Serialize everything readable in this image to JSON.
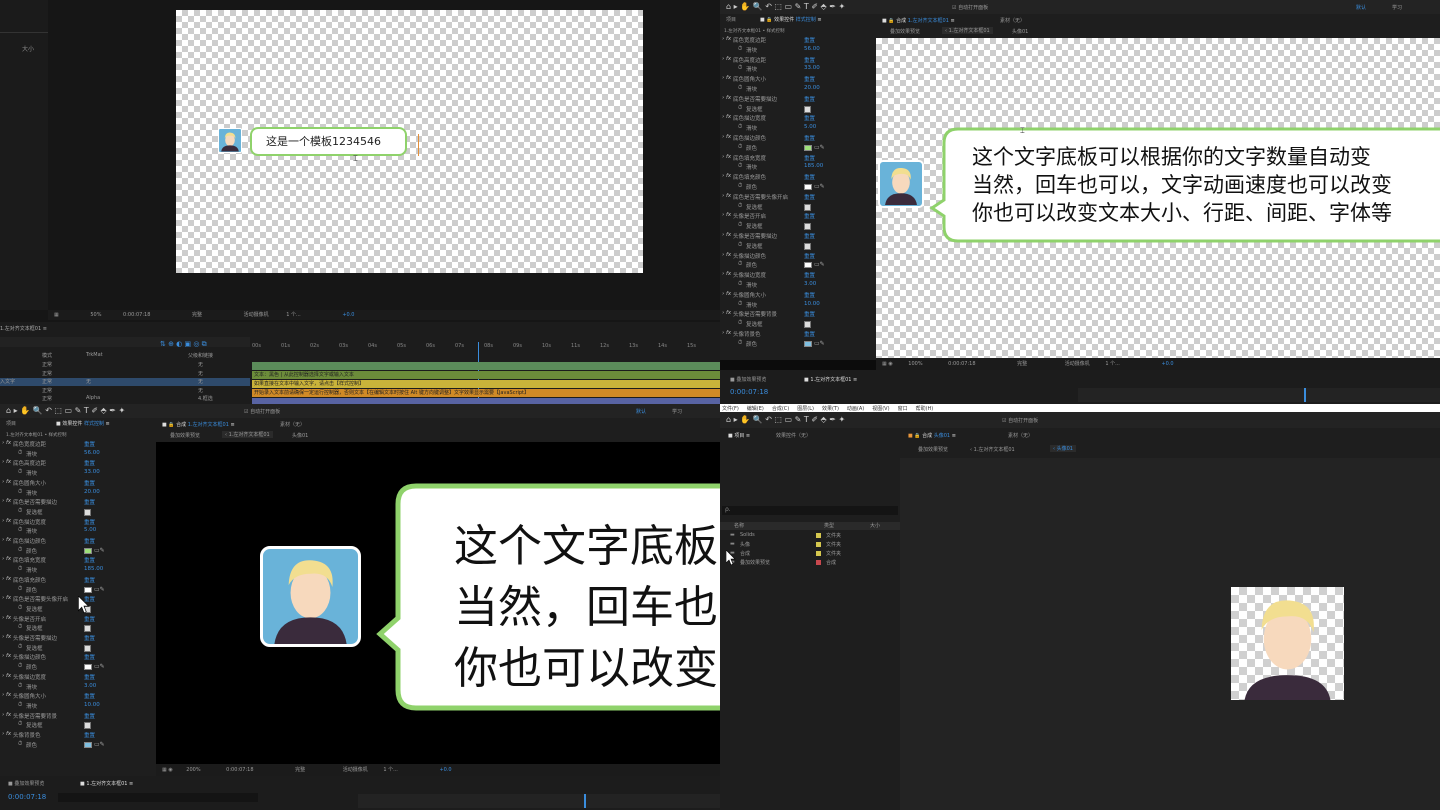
{
  "q1": {
    "left_panel_header": "大小",
    "comp_text": "这是一个模板1234546",
    "status": {
      "zoom": "50%",
      "time": "0:00:07:18",
      "quality": "完整",
      "camera": "活动摄像机",
      "views": "1 个...",
      "offset": "+0.0"
    }
  },
  "q2": {
    "menu": {
      "auto_open": "自动打开面板",
      "default": "默认",
      "learn": "学习"
    },
    "panel_tab": "效果控件",
    "panel_tab_sub": "样式控制",
    "comp_tab": "合成",
    "comp_name": "1.左对齐文本框01",
    "layer_tab": "素材（无）",
    "breadcrumb": [
      "叠加效果预览",
      "1.左对齐文本框01",
      "头像01"
    ],
    "bubble_text": [
      "这个文字底板可以根据你的文字数量自动变",
      "当然，回车也可以，文字动画速度也可以改变",
      "你也可以改变文本大小、行距、间距、字体等"
    ],
    "status": {
      "zoom": "100%",
      "time": "0:00:07:18",
      "quality": "完整",
      "camera": "活动摄像机",
      "views": "1 个...",
      "offset": "+0.0"
    },
    "timeline_tabs": [
      "叠加效果预览",
      "1.左对齐文本框01"
    ],
    "timeline_time": "0:00:07:18"
  },
  "q3": {
    "layer_header": [
      "模式",
      "TrkMat",
      "父级和链接"
    ],
    "modes": [
      "正常",
      "正常",
      "正常",
      "正常",
      "正常"
    ],
    "parent": [
      "无",
      "无",
      "无",
      "4.框选",
      "无"
    ],
    "layer_name": "入文字",
    "alpha": "Alpha",
    "ruler": [
      "00s",
      "01s",
      "02s",
      "03s",
      "04s",
      "05s",
      "06s",
      "07s",
      "08s",
      "09s",
      "10s",
      "11s",
      "12s",
      "13s",
      "14s",
      "15s"
    ],
    "tracks": [
      "",
      "文本：黑色 | 从此控制器选择文字或输入文本",
      "如果直接在文本中输入文字，请点击【样式控制】",
      "开始录入文本前请确保一定运行控制器，否则文本【在编辑文本时按住 Alt 键方向键调整】文字效果显示需要【JavaScript】",
      ""
    ],
    "auto_open": "自动打开面板",
    "default": "默认",
    "learn": "学习",
    "panel_tab": "效果控件",
    "panel_tab_sub": "样式控制",
    "comp_tab": "合成",
    "comp_name": "1.左对齐文本框01",
    "layer_tab": "素材（无）",
    "breadcrumb": [
      "叠加效果预览",
      "1.左对齐文本框01",
      "头像01"
    ],
    "bubble_text": [
      "这个文字底板",
      "当然，回车也",
      "你也可以改变"
    ],
    "status": {
      "zoom": "200%",
      "time": "0:00:07:18",
      "quality": "完整",
      "camera": "活动摄像机",
      "views": "1 个...",
      "offset": "+0.0"
    },
    "timeline_tabs": [
      "叠加效果预览",
      "1.左对齐文本框01"
    ],
    "timeline_time": "0:00:07:18"
  },
  "effects": [
    {
      "name": "底色宽度边距",
      "sub": "滑块",
      "val": "56.00",
      "type": "slider"
    },
    {
      "name": "底色高度边距",
      "sub": "滑块",
      "val": "33.00",
      "type": "slider"
    },
    {
      "name": "底色圆角大小",
      "sub": "滑块",
      "val": "20.00",
      "type": "slider"
    },
    {
      "name": "底色是否需要描边",
      "sub": "复选框",
      "val": "",
      "type": "check"
    },
    {
      "name": "底色描边宽度",
      "sub": "滑块",
      "val": "5.00",
      "type": "slider"
    },
    {
      "name": "底色描边颜色",
      "sub": "颜色",
      "val": "#9ee07a",
      "type": "color"
    },
    {
      "name": "底色填充宽度",
      "sub": "滑块",
      "val": "185.00",
      "type": "slider"
    },
    {
      "name": "底色填充颜色",
      "sub": "颜色",
      "val": "#ffffff",
      "type": "color"
    },
    {
      "name": "底色是否需要头像开启",
      "sub": "复选框",
      "val": "",
      "type": "check"
    },
    {
      "name": "头像是否开启",
      "sub": "复选框",
      "val": "",
      "type": "check"
    },
    {
      "name": "头像是否需要描边",
      "sub": "复选框",
      "val": "",
      "type": "check"
    },
    {
      "name": "头像描边颜色",
      "sub": "颜色",
      "val": "#ffffff",
      "type": "color"
    },
    {
      "name": "头像描边宽度",
      "sub": "滑块",
      "val": "3.00",
      "type": "slider"
    },
    {
      "name": "头像圆角大小",
      "sub": "滑块",
      "val": "10.00",
      "type": "slider"
    },
    {
      "name": "头像是否需要背景",
      "sub": "复选框",
      "val": "",
      "type": "check"
    },
    {
      "name": "头像背景色",
      "sub": "颜色",
      "val": "#7fbfe0",
      "type": "color"
    }
  ],
  "reset_label": "重置",
  "effects_header": "1.左对齐文本框01 • 样式控制",
  "q4": {
    "menu": [
      "文件(F)",
      "编辑(E)",
      "合成(C)",
      "图层(L)",
      "效果(T)",
      "动画(A)",
      "视图(V)",
      "窗口",
      "帮助(H)"
    ],
    "auto_open": "自动打开面板",
    "project_tab": "项目",
    "effects_tab": "效果控件（无）",
    "comp_tab": "合成",
    "comp_name": "头像01",
    "layer_tab": "素材（无）",
    "breadcrumb": [
      "叠加效果预览",
      "1.左对齐文本框01",
      "头像01"
    ],
    "search_placeholder": "ρ.",
    "columns": [
      "名称",
      "类型",
      "大小"
    ],
    "items": [
      {
        "name": "Solids",
        "type": "文件夹",
        "color": "#d6c84f"
      },
      {
        "name": "头像",
        "type": "文件夹",
        "color": "#d6c84f"
      },
      {
        "name": "合成",
        "type": "文件夹",
        "color": "#d6c84f"
      },
      {
        "name": "叠加效果预览",
        "type": "合成",
        "color": "#c8484e"
      }
    ]
  },
  "colors": {
    "bubble_border": "#8fd26b",
    "avatar_bg": "#69b3d9",
    "hair": "#f2de90",
    "shirt": "#3a2b3c",
    "accent": "#3a8ddd"
  }
}
